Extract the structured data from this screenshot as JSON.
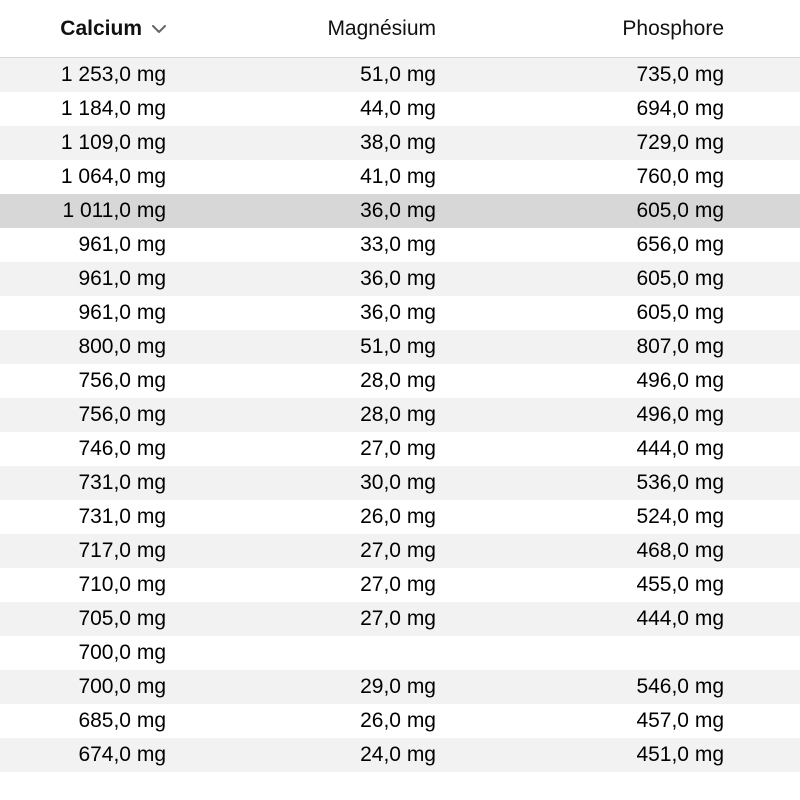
{
  "columns": {
    "calcium": "Calcium",
    "magnesium": "Magnésium",
    "phosphore": "Phosphore"
  },
  "sort": {
    "column": "calcium",
    "direction": "desc"
  },
  "selected_row_index": 4,
  "rows": [
    {
      "calcium": "1 253,0 mg",
      "magnesium": "51,0 mg",
      "phosphore": "735,0 mg"
    },
    {
      "calcium": "1 184,0 mg",
      "magnesium": "44,0 mg",
      "phosphore": "694,0 mg"
    },
    {
      "calcium": "1 109,0 mg",
      "magnesium": "38,0 mg",
      "phosphore": "729,0 mg"
    },
    {
      "calcium": "1 064,0 mg",
      "magnesium": "41,0 mg",
      "phosphore": "760,0 mg"
    },
    {
      "calcium": "1 011,0 mg",
      "magnesium": "36,0 mg",
      "phosphore": "605,0 mg"
    },
    {
      "calcium": "961,0 mg",
      "magnesium": "33,0 mg",
      "phosphore": "656,0 mg"
    },
    {
      "calcium": "961,0 mg",
      "magnesium": "36,0 mg",
      "phosphore": "605,0 mg"
    },
    {
      "calcium": "961,0 mg",
      "magnesium": "36,0 mg",
      "phosphore": "605,0 mg"
    },
    {
      "calcium": "800,0 mg",
      "magnesium": "51,0 mg",
      "phosphore": "807,0 mg"
    },
    {
      "calcium": "756,0 mg",
      "magnesium": "28,0 mg",
      "phosphore": "496,0 mg"
    },
    {
      "calcium": "756,0 mg",
      "magnesium": "28,0 mg",
      "phosphore": "496,0 mg"
    },
    {
      "calcium": "746,0 mg",
      "magnesium": "27,0 mg",
      "phosphore": "444,0 mg"
    },
    {
      "calcium": "731,0 mg",
      "magnesium": "30,0 mg",
      "phosphore": "536,0 mg"
    },
    {
      "calcium": "731,0 mg",
      "magnesium": "26,0 mg",
      "phosphore": "524,0 mg"
    },
    {
      "calcium": "717,0 mg",
      "magnesium": "27,0 mg",
      "phosphore": "468,0 mg"
    },
    {
      "calcium": "710,0 mg",
      "magnesium": "27,0 mg",
      "phosphore": "455,0 mg"
    },
    {
      "calcium": "705,0 mg",
      "magnesium": "27,0 mg",
      "phosphore": "444,0 mg"
    },
    {
      "calcium": "700,0 mg",
      "magnesium": "",
      "phosphore": ""
    },
    {
      "calcium": "700,0 mg",
      "magnesium": "29,0 mg",
      "phosphore": "546,0 mg"
    },
    {
      "calcium": "685,0 mg",
      "magnesium": "26,0 mg",
      "phosphore": "457,0 mg"
    },
    {
      "calcium": "674,0 mg",
      "magnesium": "24,0 mg",
      "phosphore": "451,0 mg"
    }
  ]
}
